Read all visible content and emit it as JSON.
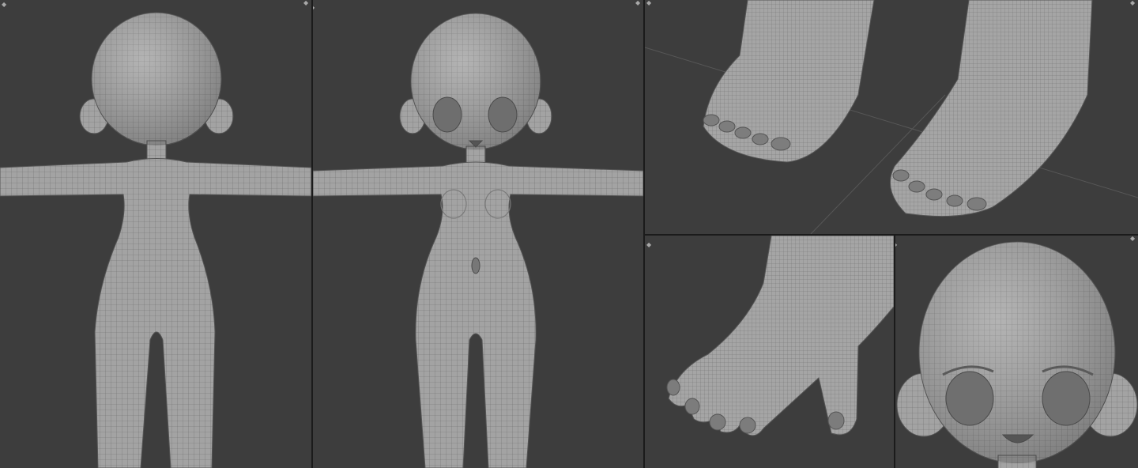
{
  "app": "3D modeling viewport layout",
  "viewports": [
    {
      "id": "back",
      "content": "character-mesh-back-view"
    },
    {
      "id": "front",
      "content": "character-mesh-front-view"
    },
    {
      "id": "feet",
      "content": "feet-closeup"
    },
    {
      "id": "hand",
      "content": "hand-closeup"
    },
    {
      "id": "head",
      "content": "head-closeup"
    }
  ],
  "colors": {
    "background": "#3d3d3d",
    "separator": "#1b1b1b",
    "mesh": "#9c9c9c",
    "wire": "#6e6e6e"
  },
  "icons": {
    "corner": "viewport-corner-widget-icon"
  }
}
